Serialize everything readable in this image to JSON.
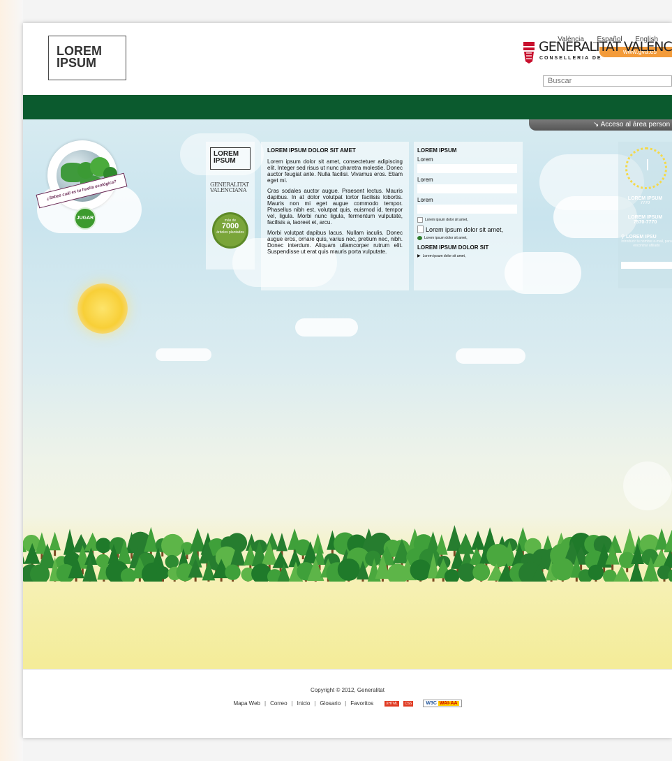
{
  "header": {
    "languages": [
      "_València",
      "_Español",
      "_English"
    ],
    "gva_link": "www.gva.es",
    "logo_line1": "LOREM",
    "logo_line2": "IPSUM",
    "brand_title": "GENERALITAT VALENCIANA",
    "brand_sub": "CONSELLERIA DE",
    "search_placeholder": "Buscar"
  },
  "access_tab": "Acceso al área person",
  "game_badge": {
    "ribbon_text": "¿Sabes cuál es tu huella ecológica?",
    "play_label": "JUGAR"
  },
  "left_logos": {
    "logo_line1": "LOREM",
    "logo_line2": "IPSUM",
    "gen_line1": "GENERALITAT",
    "gen_line2": "VALENCIANA",
    "counter_pre": "más de",
    "counter_value": "7000",
    "counter_post": "árboles plantados"
  },
  "article": {
    "title": "LOREM IPSUM DOLOR SIT AMET",
    "p1": "Lorem ipsum dolor sit amet, consectetuer adipiscing elit. Integer sed risus ut nunc pharetra molestie. Donec auctor feugiat ante. Nulla facilisi. Vivamus eros. Etiam eget mi.",
    "p2": "Cras sodales auctor augue. Praesent lectus. Mauris dapibus. In at dolor volutpat tortor facilisis lobortis. Mauris non mi eget augue commodo tempor. Phasellus nibh est, volutpat quis, euismod id, tempor vel, ligula. Morbi nunc ligula, fermentum vulputate, facilisis a, laoreet et, arcu.",
    "p3": "Morbi volutpat dapibus lacus. Nullam iaculis. Donec augue eros, ornare quis, varius nec, pretium nec, nibh. Donec interdum. Aliquam ullamcorper rutrum elit. Suspendisse ut erat quis mauris porta vulputate."
  },
  "form": {
    "title": "LOREM IPSUM",
    "label1": "Lorem",
    "label2": "Lorem",
    "label3": "Lorem",
    "checkbox_text": "Lorem ipsum dolor sit amet,",
    "doc_link": "Lorem ipsum dolor sit amet,",
    "tree_link": "Lorem ipsum dolor sit amet,",
    "subtitle": "LOREM IPSUM DOLOR SIT",
    "arrow_link": "Lorem ipsum dolor sit amet,"
  },
  "right_panel": {
    "block1_title": "LOREM IPSUM",
    "block1_value": "7770",
    "block2_title": "LOREM IPSUM",
    "block2_value": "7570-7770",
    "block3_title": "LOREM IPSU",
    "block3_text": "Introducir tu nombre e-mail, para encontrar afiliado"
  },
  "footer": {
    "copyright": "Copyright © 2012, Generalitat",
    "links": [
      "Mapa Web",
      "Correo",
      "Inicio",
      "Glosario",
      "Favoritos"
    ],
    "separator": "|",
    "badge_xhtml": "XHTML",
    "badge_css": "CSS",
    "badge_w3c": "W3C",
    "badge_wai": "WAI-AA"
  },
  "colors": {
    "header_bar": "#0b5a2e",
    "accent_orange": "#f39b3a",
    "sky_top": "#d7ebf1",
    "meadow": "#f4ec98"
  }
}
